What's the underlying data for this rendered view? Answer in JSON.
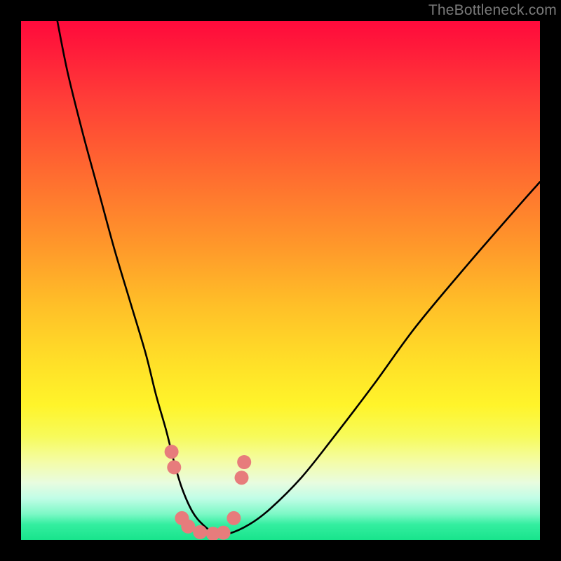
{
  "watermark": {
    "text": "TheBottleneck.com"
  },
  "colors": {
    "frame": "#000000",
    "curve_stroke": "#000000",
    "marker_fill": "#e77c7c",
    "marker_stroke": "#da6a6a",
    "gradient_top": "#ff0a3c",
    "gradient_bottom": "#18e48c"
  },
  "chart_data": {
    "type": "line",
    "title": "",
    "xlabel": "",
    "ylabel": "",
    "xlim": [
      0,
      100
    ],
    "ylim": [
      0,
      100
    ],
    "series": [
      {
        "name": "curve",
        "x": [
          7,
          9,
          12,
          15,
          18,
          21,
          24,
          26,
          28,
          29.5,
          31,
          33,
          35,
          37.5,
          40,
          44,
          48,
          54,
          60,
          68,
          76,
          86,
          96,
          100
        ],
        "y": [
          100,
          90,
          78,
          67,
          56,
          46,
          36,
          28,
          21,
          15,
          10,
          5.5,
          3,
          1.2,
          1.2,
          3,
          6,
          12,
          19.5,
          30,
          41,
          53,
          64.5,
          69
        ]
      }
    ],
    "markers": [
      {
        "x": 29,
        "y": 17
      },
      {
        "x": 29.5,
        "y": 14
      },
      {
        "x": 31,
        "y": 4.2
      },
      {
        "x": 32.2,
        "y": 2.6
      },
      {
        "x": 34.5,
        "y": 1.5
      },
      {
        "x": 37,
        "y": 1.2
      },
      {
        "x": 39,
        "y": 1.4
      },
      {
        "x": 41,
        "y": 4.2
      },
      {
        "x": 42.5,
        "y": 12
      },
      {
        "x": 43,
        "y": 15
      }
    ]
  }
}
